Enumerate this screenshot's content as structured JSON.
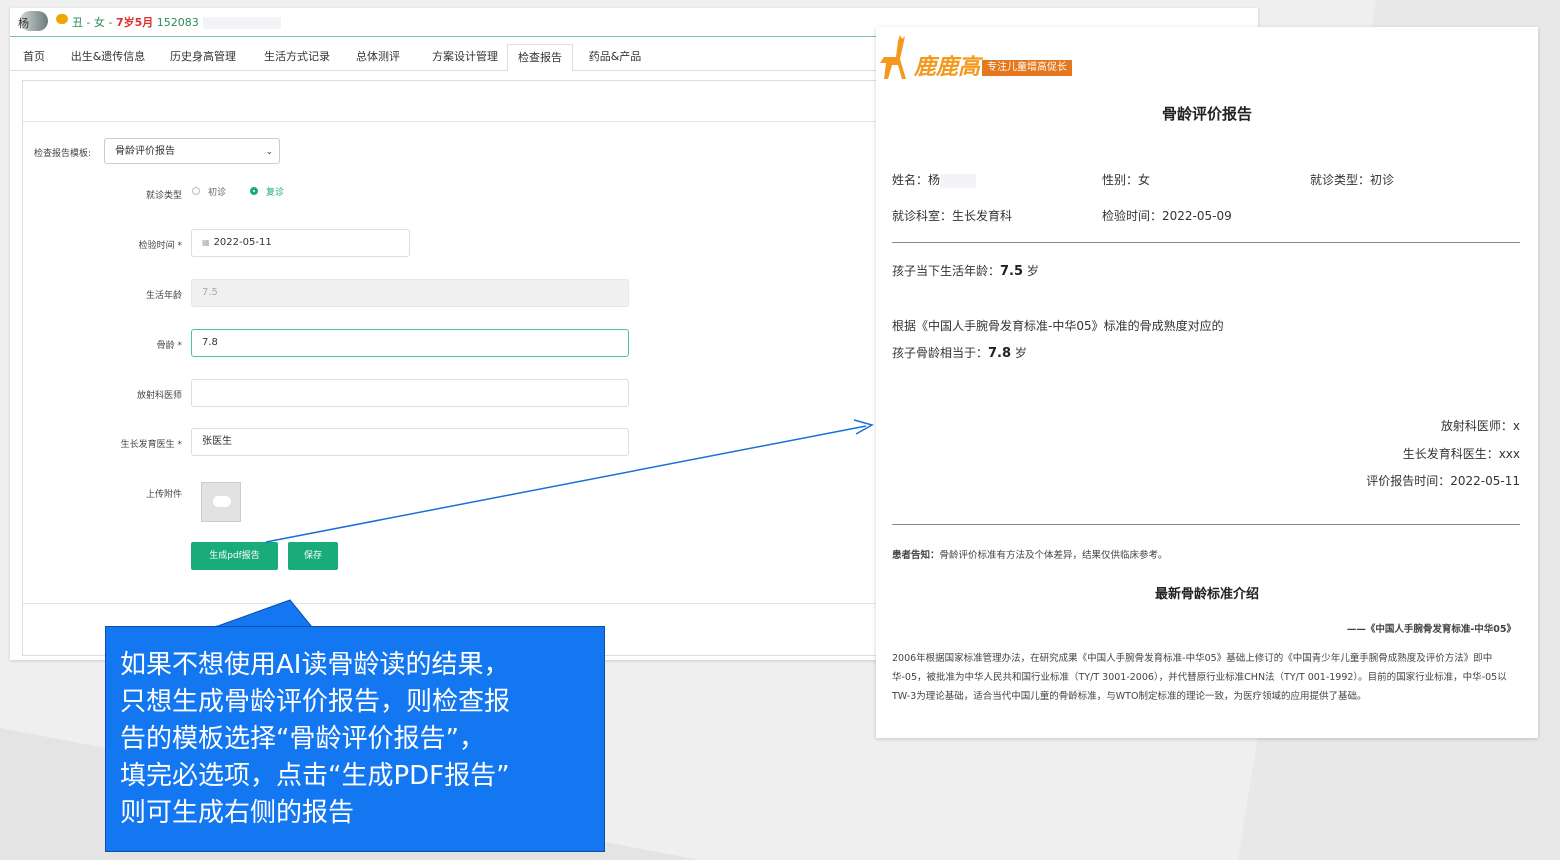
{
  "app": {
    "title_prefix": "杨",
    "title_info": "丑 - 女 - ",
    "title_age": "7岁5月",
    "title_id": "152083"
  },
  "tabs": [
    "首页",
    "出生&遗传信息",
    "历史身高管理",
    "生活方式记录",
    "总体测评",
    "方案设计管理",
    "检查报告",
    "药品&产品"
  ],
  "form": {
    "template_label": "检查报告模板:",
    "template_value": "骨龄评价报告",
    "visit_type_label": "就诊类型",
    "visit_opt_first": "初诊",
    "visit_opt_return": "复诊",
    "test_time_label": "检验时间 *",
    "test_time_value": "2022-05-11",
    "life_age_label": "生活年龄",
    "life_age_value": "7.5",
    "bone_age_label": "骨龄 *",
    "bone_age_value": "7.8",
    "radiologist_label": "放射科医师",
    "radiologist_value": "",
    "growth_doctor_label": "生长发育医生 *",
    "growth_doctor_value": "张医生",
    "upload_label": "上传附件",
    "btn_generate": "生成pdf报告",
    "btn_save": "保存"
  },
  "callout": {
    "text": "如果不想使用AI读骨龄读的结果，\n只想生成骨龄评价报告，则检查报\n告的模板选择“骨龄评价报告”，\n填完必选项，点击“生成PDF报告”\n则可生成右侧的报告"
  },
  "report": {
    "logo_text": "鹿鹿高",
    "logo_tagline": "专注儿童增高促长",
    "title": "骨龄评价报告",
    "name_label": "姓名：杨",
    "gender": "性别：女",
    "visit_type": "就诊类型：初诊",
    "dept": "就诊科室：生长发育科",
    "test_time": "检验时间：2022-05-09",
    "life_age_prefix": "孩子当下生活年龄：",
    "life_age_value": "7.5",
    "life_age_unit": " 岁",
    "basis_text": "根据《中国人手腕骨发育标准-中华05》标准的骨成熟度对应的",
    "bone_age_prefix": "孩子骨龄相当于：",
    "bone_age_value": "7.8",
    "bone_age_unit": " 岁",
    "radiologist": "放射科医师：x",
    "growth_doctor": "生长发育科医生：xxx",
    "report_time": "评价报告时间：2022-05-11",
    "notice_bold": "患者告知：",
    "notice_text": "骨龄评价标准有方法及个体差异，结果仅供临床参考。",
    "section_title": "最新骨龄标准介绍",
    "section_source": "——《中国人手腕骨发育标准-中华05》",
    "section_body": "2006年根据国家标准管理办法，在研究成果《中国人手腕骨发育标准-中华05》基础上修订的《中国青少年儿童手腕骨成熟度及评价方法》即中华-05，被批准为中华人民共和国行业标准（TY/T 3001-2006），并代替原行业标准CHN法（TY/T 001-1992）。目前的国家行业标准，中华-05以TW-3为理论基础，适合当代中国儿童的骨龄标准，与WTO制定标准的理论一致，为医疗领域的应用提供了基础。"
  },
  "colors": {
    "accent": "#1aab7b",
    "callout": "#1477f2",
    "arrow": "#1a6fd6",
    "logo_orange": "#f39a1e"
  }
}
